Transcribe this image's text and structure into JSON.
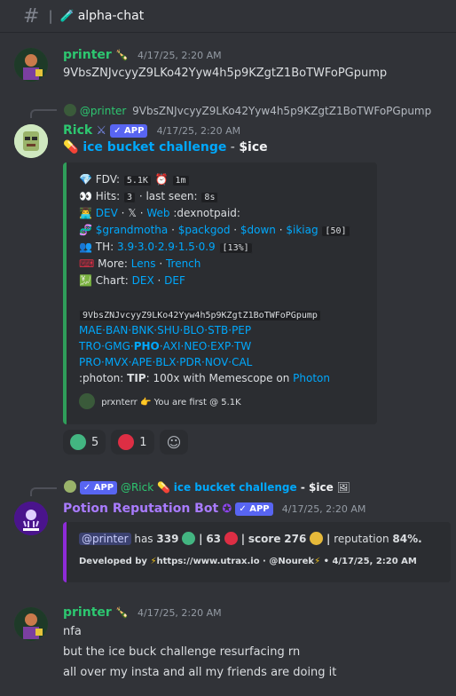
{
  "header": {
    "channel_emoji": "🧪",
    "channel_name": "alpha-chat",
    "separator": "|"
  },
  "msg1": {
    "username": "printer",
    "username_emoji": "🍾",
    "timestamp": "4/17/25, 2:20 AM",
    "text": "9VbsZNJvcyyZ9LKo42Yyw4h5p9KZgtZ1BoTWFoPGpump"
  },
  "msg2": {
    "reply_author": "@printer",
    "reply_text": "9VbsZNJvcyyZ9LKo42Yyw4h5p9KZgtZ1BoTWFoPGpump",
    "username": "Rick",
    "badge": "APP",
    "timestamp": "4/17/25, 2:20 AM",
    "title_link": "ice bucket challenge",
    "title_sep": " - ",
    "title_ticker": "$ice",
    "embed": {
      "fdv_label": "FDV:",
      "fdv_value": "5.1K",
      "fdv_age": "1m",
      "hits_label": "Hits:",
      "hits_value": "3",
      "last_seen_label": "· last seen:",
      "last_seen_value": "8s",
      "dev_link": "DEV",
      "x_link": "𝕏",
      "web_link": "Web",
      "dexnotpaid": ":dexnotpaid:",
      "tags": [
        "$grandmotha",
        "$packgod",
        "$down",
        "$ikiag"
      ],
      "tags_count": "[50]",
      "th_label": "TH:",
      "th_values": "3.9·3.0·2.9·1.5·0.9",
      "th_pct": "[13%]",
      "more_label": "More:",
      "more_link1": "Lens",
      "more_link2": "Trench",
      "chart_label": "Chart:",
      "chart_link1": "DEX",
      "chart_link2": "DEF",
      "contract": "9VbsZNJvcyyZ9LKo42Yyw4h5p9KZgtZ1BoTWFoPGpump",
      "exch_row1": "MAE·BAN·BNK·SHU·BLO·STB·PEP",
      "exch_row2a": "TRO·GMG·",
      "exch_row2_bold": "PHO",
      "exch_row2b": "·AXI·NEO·EXP·TW",
      "exch_row3": "PRO·MVX·APE·BLX·PDR·NOV·CAL",
      "photon_prefix": ":photon:",
      "tip_label": "TIP",
      "tip_text": ": 100x with Memescope on",
      "tip_link": "Photon",
      "footer_user": "prxnterr",
      "footer_text": "You are first @ 5.1K"
    },
    "reactions": [
      {
        "color": "#43b581",
        "count": "5"
      },
      {
        "color": "#dd2e44",
        "count": "1"
      }
    ]
  },
  "msg3": {
    "reply_badge": "APP",
    "reply_author": "@Rick",
    "reply_link": "ice bucket challenge",
    "reply_ticker": " - $ice",
    "username": "Potion Reputation Bot",
    "badge": "APP",
    "timestamp": "4/17/25, 2:20 AM",
    "embed": {
      "mention": "@printer",
      "has_label": "has",
      "wins": "339",
      "losses": "63",
      "score_label": "score",
      "score_value": "276",
      "rep_label": "reputation",
      "rep_value": "84%.",
      "dev_by": "Developed by",
      "dev_url": "https://www.utrax.io",
      "dev_handle": "· @Nourek",
      "dev_time": "• 4/17/25, 2:20 AM"
    }
  },
  "msg4": {
    "username": "printer",
    "username_emoji": "🍾",
    "timestamp": "4/17/25, 2:20 AM",
    "lines": [
      "nfa",
      "but the ice buck challenge resurfacing rn",
      "all over my insta and all my friends are doing it"
    ]
  },
  "colors": {
    "accent": "#5865f2",
    "green_user": "#2dc770",
    "link": "#00a8fc",
    "purple_user": "#a97bff",
    "embed_green": "#2f9e5a",
    "embed_purple": "#8e2bd8"
  }
}
